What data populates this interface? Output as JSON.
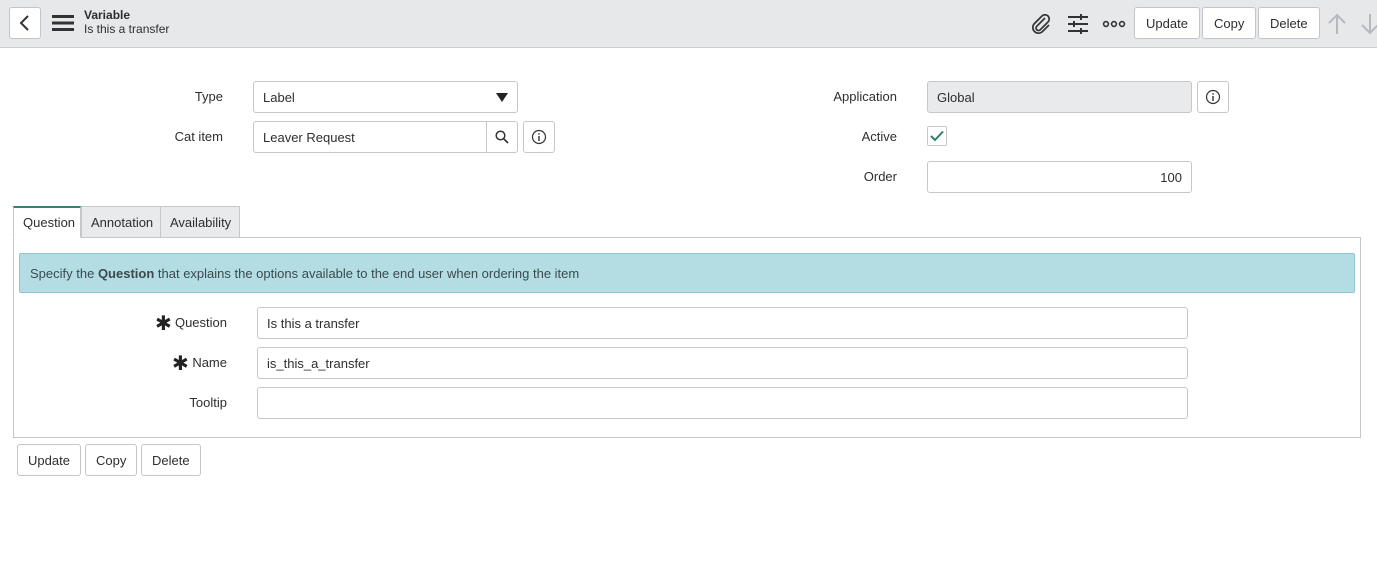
{
  "header": {
    "title": "Variable",
    "subtitle": "Is this a transfer",
    "buttons": {
      "update": "Update",
      "copy": "Copy",
      "delete": "Delete"
    }
  },
  "form": {
    "type": {
      "label": "Type",
      "value": "Label"
    },
    "cat_item": {
      "label": "Cat item",
      "value": "Leaver Request"
    },
    "application": {
      "label": "Application",
      "value": "Global"
    },
    "active": {
      "label": "Active",
      "checked": true
    },
    "order": {
      "label": "Order",
      "value": "100"
    }
  },
  "tabs": [
    {
      "label": "Question",
      "active": true
    },
    {
      "label": "Annotation",
      "active": false
    },
    {
      "label": "Availability",
      "active": false
    }
  ],
  "question_tab": {
    "info_prefix": "Specify the ",
    "info_bold": "Question",
    "info_suffix": " that explains the options available to the end user when ordering the item",
    "question": {
      "label": "Question",
      "value": "Is this a transfer"
    },
    "name": {
      "label": "Name",
      "value": "is_this_a_transfer"
    },
    "tooltip": {
      "label": "Tooltip",
      "value": ""
    }
  },
  "footer": {
    "update": "Update",
    "copy": "Copy",
    "delete": "Delete"
  },
  "colors": {
    "header_bg": "#e6e8ea",
    "info_bg": "#b3dde3",
    "accent": "#3b7f6f",
    "check": "#2e7d6a"
  }
}
